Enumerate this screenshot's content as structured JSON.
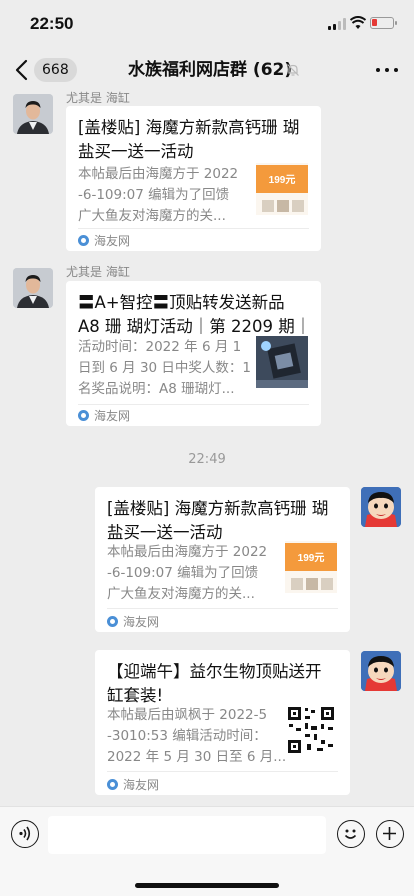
{
  "status_bar": {
    "time": "22:50"
  },
  "navbar": {
    "unread_count": "668",
    "title": "水族福利网店群 (62)"
  },
  "messages": [
    {
      "sender": "尤其是 海缸",
      "title_lines": [
        "[盖楼贴] 海魔方新款高钙珊 瑚",
        "盐买一送一活动"
      ],
      "desc_lines": [
        "本帖最后由海魔方于 2022",
        "-6-109:07 编辑为了回馈",
        "广大鱼友对海魔方的关..."
      ],
      "source": "海友网"
    },
    {
      "sender": "尤其是 海缸",
      "title_lines": [
        "〓A+智控〓顶贴转发送新品",
        "A8 珊 瑚灯活动｜第 2209 期｜"
      ],
      "desc_lines": [
        "活动时间：2022 年 6 月 1",
        "日到 6 月 30 日中奖人数：1",
        "名奖品说明：A8 珊瑚灯..."
      ],
      "source": "海友网"
    },
    {
      "title_lines": [
        "[盖楼贴] 海魔方新款高钙珊 瑚",
        "盐买一送一活动"
      ],
      "desc_lines": [
        "本帖最后由海魔方于 2022",
        "-6-109:07 编辑为了回馈",
        "广大鱼友对海魔方的关..."
      ],
      "source": "海友网"
    },
    {
      "title_lines": [
        "【迎端午】益尔生物顶贴送开",
        "缸套装!"
      ],
      "desc_lines": [
        "本帖最后由飒枫于 2022-5",
        "-3010:53 编辑活动时间：",
        "2022 年 5 月 30 日至 6 月..."
      ],
      "source": "海友网"
    }
  ],
  "time_divider": "22:49",
  "thumb_price_text": "199元",
  "colors": {
    "background": "#ededed",
    "card": "#ffffff",
    "accent_orange": "#f49a3c",
    "bottom_bar": "#f7f7f7"
  },
  "icons": {
    "back": "chevron-left-icon",
    "mute": "bell-slash-icon",
    "more": "more-dots-icon",
    "voice": "voice-icon",
    "emoji": "emoji-icon",
    "plus": "plus-icon",
    "source": "haiyouwang-logo-icon"
  }
}
